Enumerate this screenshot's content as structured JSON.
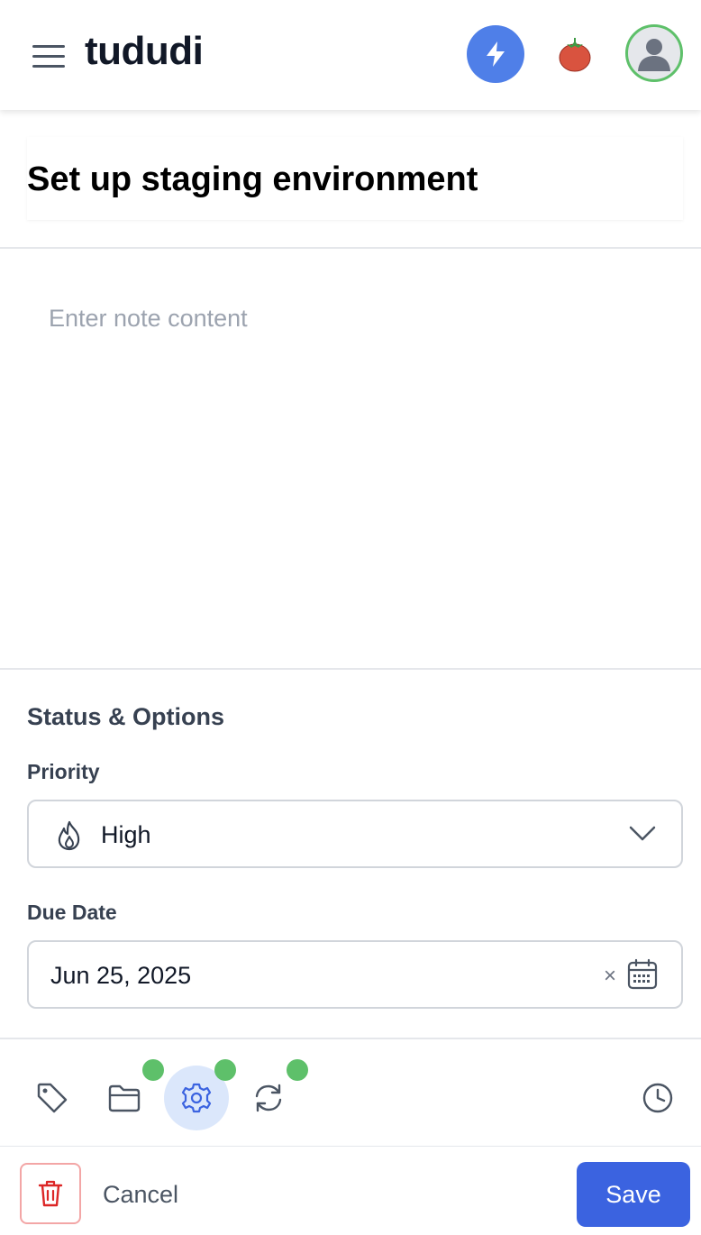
{
  "header": {
    "brand": "tududi",
    "icons": {
      "menu": "hamburger-icon",
      "quick": "lightning-icon",
      "pomodoro": "tomato-icon",
      "profile": "user-avatar"
    },
    "colors": {
      "quick_bg": "#4f7fe8",
      "avatar_ring": "#5ec06a"
    }
  },
  "task": {
    "title": "Set up staging environment",
    "note_placeholder": "Enter note content"
  },
  "status_section": {
    "heading": "Status & Options",
    "priority_label": "Priority",
    "priority_value": "High",
    "due_date_label": "Due Date",
    "due_date_value": "Jun 25, 2025",
    "clear_symbol": "×"
  },
  "toolbar": {
    "items": [
      "tag-icon",
      "folder-icon",
      "gear-icon",
      "repeat-icon",
      "clock-icon"
    ],
    "active": "gear-icon",
    "indicator_color": "#5ec06a",
    "active_bg": "#dbe7fb"
  },
  "footer": {
    "cancel_label": "Cancel",
    "save_label": "Save",
    "save_color": "#3b63e0",
    "delete_icon": "trash-icon"
  }
}
